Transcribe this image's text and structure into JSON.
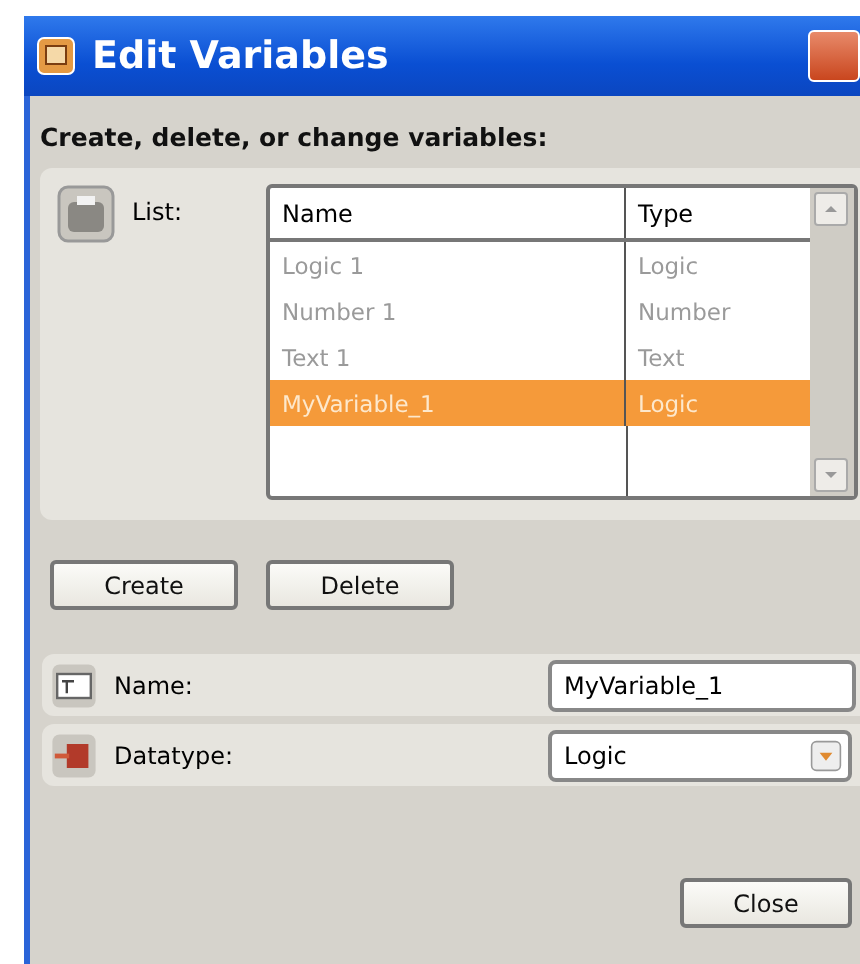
{
  "window": {
    "title": "Edit Variables"
  },
  "instruction": "Create, delete, or change variables:",
  "list": {
    "label": "List:",
    "columns": [
      "Name",
      "Type"
    ],
    "rows": [
      {
        "name": "Logic 1",
        "type": "Logic",
        "selected": false
      },
      {
        "name": "Number 1",
        "type": "Number",
        "selected": false
      },
      {
        "name": "Text 1",
        "type": "Text",
        "selected": false
      },
      {
        "name": "MyVariable_1",
        "type": "Logic",
        "selected": true
      }
    ]
  },
  "buttons": [
    "Create",
    "Delete"
  ],
  "fields": [
    {
      "kind": "text",
      "label": "Name:",
      "value": "MyVariable_1"
    },
    {
      "kind": "dropdown",
      "label": "Datatype:",
      "value": "Logic"
    }
  ],
  "close_button": "Close"
}
